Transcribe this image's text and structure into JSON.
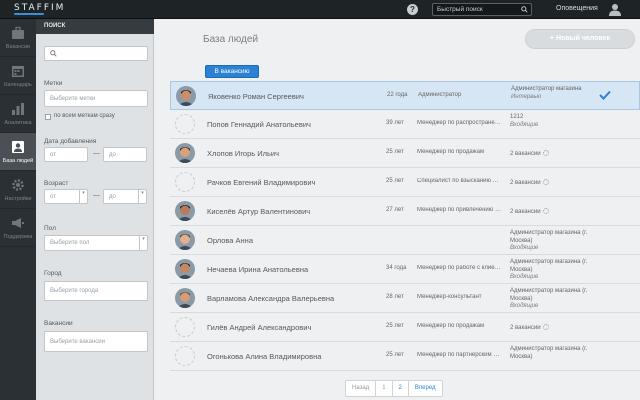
{
  "app": {
    "logo": "STAFFIM"
  },
  "topbar": {
    "help_icon": "?",
    "search_placeholder": "Быстрый поиск",
    "notifications": "Оповещения",
    "user_icon": "user-icon"
  },
  "nav": {
    "items": [
      {
        "label": "Вакансии",
        "icon": "vacancies-icon"
      },
      {
        "label": "Календарь",
        "icon": "calendar-icon"
      },
      {
        "label": "Аналитика",
        "icon": "analytics-icon"
      },
      {
        "label": "База людей",
        "icon": "people-base-icon",
        "active": true
      },
      {
        "label": "Настройки",
        "icon": "settings-icon"
      },
      {
        "label": "Поддержка",
        "icon": "support-icon"
      }
    ]
  },
  "filters": {
    "header": "ПОИСК",
    "tags_label": "Метки",
    "tags_placeholder": "Выберите метки",
    "all_tags_label": "по всем меткам сразу",
    "date_label": "Дата добавления",
    "date_from": "от",
    "date_to": "до",
    "dash": "—",
    "age_label": "Возраст",
    "age_from": "от",
    "age_to": "до",
    "sex_label": "Пол",
    "sex_placeholder": "Выберите пол",
    "city_label": "Город",
    "city_placeholder": "Выберите города",
    "vacancies_label": "Вакансии",
    "vacancies_placeholder": "Выберите вакансии"
  },
  "main": {
    "title": "База людей",
    "new_person_button": "+ Новый человек",
    "to_vacancy_button": "В вакансию",
    "rows": [
      {
        "name": "Яковенко Роман Сергеевич",
        "age": "22 года",
        "position": "Администратор",
        "vacancy": "Администратор магазина",
        "status": "Интервью",
        "photo": true,
        "selected": true
      },
      {
        "name": "Попов Геннадий Анатольевич",
        "age": "39 лет",
        "position": "Менеджер по распростране…",
        "vacancy": "1212",
        "status": "Входящие",
        "photo": false
      },
      {
        "name": "Хлопов Игорь Ильич",
        "age": "25 лет",
        "position": "Менеджер по продажам",
        "vacancy_count": "2 вакансии",
        "photo": true
      },
      {
        "name": "Рачков Евгений Владимирович",
        "age": "25 лет",
        "position": "Специалист по взысканию …",
        "vacancy_count": "2 вакансии",
        "photo": false
      },
      {
        "name": "Киселёв Артур Валентинович",
        "age": "27 лет",
        "position": "Менеджер по привлечению …",
        "vacancy_count": "2 вакансии",
        "photo": true
      },
      {
        "name": "Орлова Анна",
        "age": "",
        "position": "",
        "vacancy": "Администратор магазина (г. Москва)",
        "status": "Входящие",
        "photo": true
      },
      {
        "name": "Нечаева Ирина Анатольевна",
        "age": "34 года",
        "position": "Менеджер по работе с клие…",
        "vacancy": "Администратор магазина (г. Москва)",
        "status": "Входящие",
        "photo": true
      },
      {
        "name": "Варламова Александра Валерьевна",
        "age": "28 лет",
        "position": "Менеджер-консультант",
        "vacancy": "Администратор магазина (г. Москва)",
        "status": "Входящие",
        "photo": true
      },
      {
        "name": "Гилёв Андрей Александрович",
        "age": "25 лет",
        "position": "Менеджер по продажам",
        "vacancy_count": "2 вакансии",
        "photo": false
      },
      {
        "name": "Огонькова Алина Владимировна",
        "age": "25 лет",
        "position": "Менеджер по партнерским …",
        "vacancy": "Администратор магазина (г. Москва)",
        "status": "",
        "photo": false
      }
    ]
  },
  "pagination": {
    "prev": "Назад",
    "pages": [
      "1",
      "2"
    ],
    "next": "Вперед"
  },
  "colors": {
    "accent": "#2b82d4",
    "sidebar": "#2b3034",
    "topbar": "#1e2326",
    "selected_row": "#d6e6f4"
  }
}
